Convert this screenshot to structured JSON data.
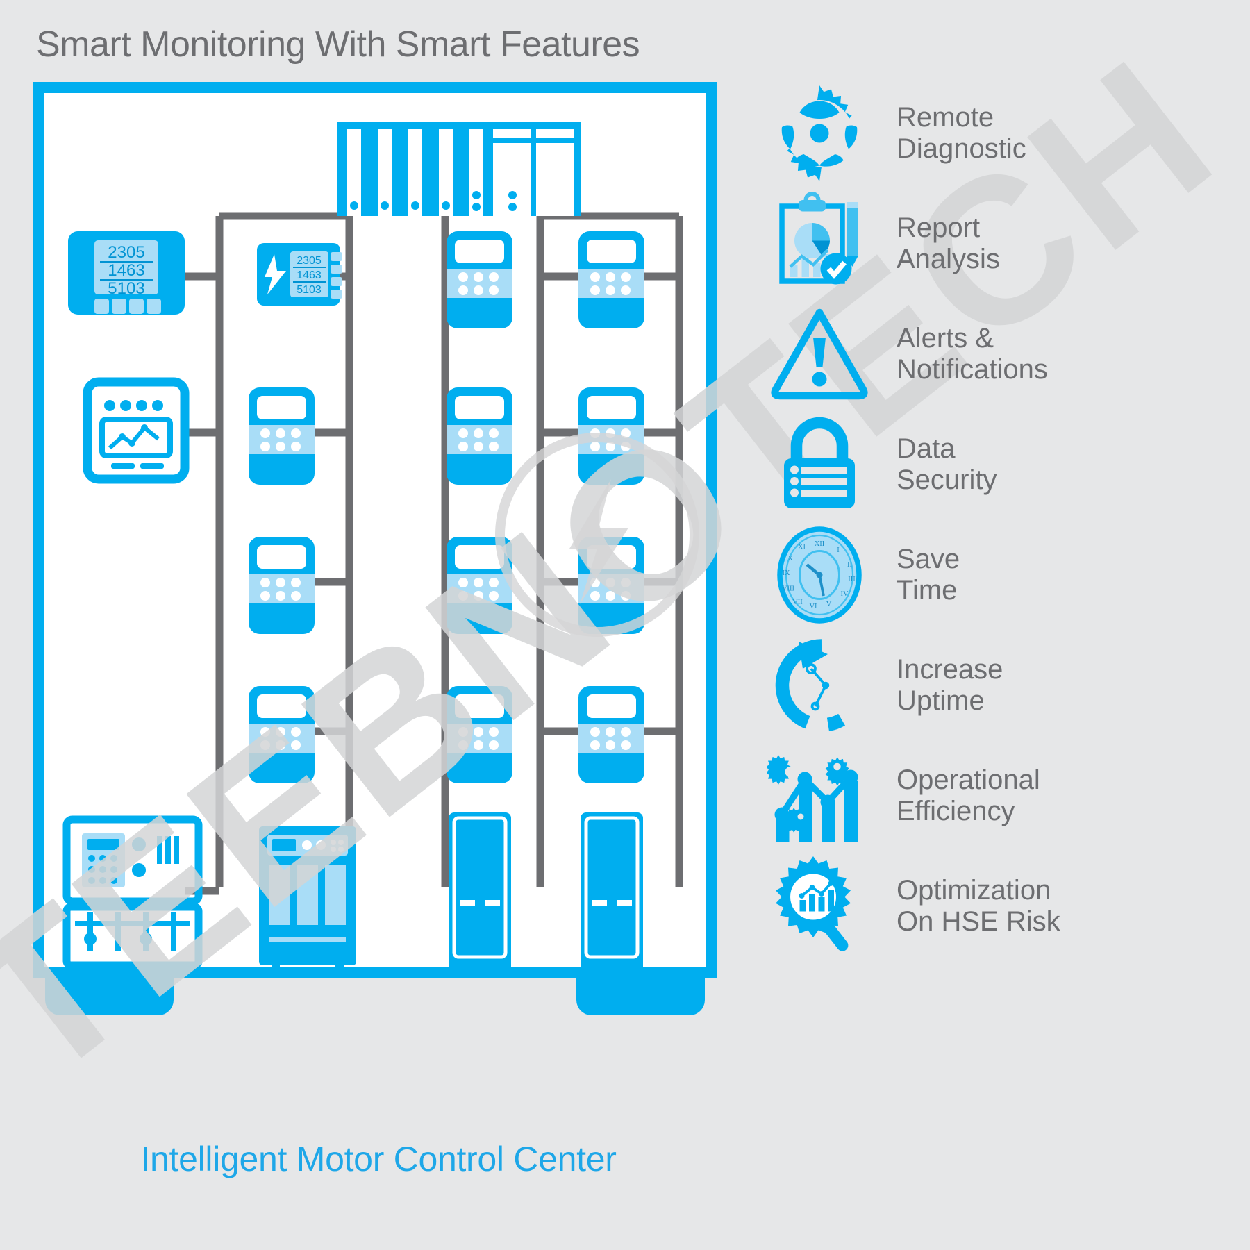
{
  "header": {
    "title": "Smart Monitoring With Smart Features"
  },
  "cabinet": {
    "caption": "Intelligent Motor Control Center",
    "accent_color": "#00aeef",
    "accent_light": "#a9ddf7",
    "accent_mid": "#41c0f0",
    "wire_color": "#6d6e71",
    "background": "#ffffff",
    "page_background": "#e6e7e8",
    "text_color": "#6d6e71"
  },
  "watermark": {
    "text": "TEEBNOTECH"
  },
  "meters": {
    "display_values": [
      "2305",
      "1463",
      "5103"
    ],
    "power_meter_name": "power-meter-display",
    "relay_name": "protection-relay-display"
  },
  "devices": [
    {
      "name": "plc-rack",
      "label": "PLC Rack"
    },
    {
      "name": "power-meter",
      "label": "Power Meter"
    },
    {
      "name": "protection-relay",
      "label": "Protection Relay"
    },
    {
      "name": "monitoring-display",
      "label": "Monitoring Display"
    },
    {
      "name": "operator-console",
      "label": "Operator Console"
    },
    {
      "name": "switchgear-panel",
      "label": "Switchgear Panel"
    },
    {
      "name": "mcc-bucket",
      "label": "MCC Bucket"
    },
    {
      "name": "vertical-drive-cabinet",
      "label": "Drive Cabinet"
    }
  ],
  "features": [
    {
      "icon": "gear-icon",
      "label": "Remote\nDiagnostic"
    },
    {
      "icon": "clipboard-chart-icon",
      "label": "Report\nAnalysis"
    },
    {
      "icon": "warning-triangle-icon",
      "label": "Alerts &\nNotifications"
    },
    {
      "icon": "padlock-icon",
      "label": "Data\nSecurity"
    },
    {
      "icon": "clock-icon",
      "label": "Save\nTime"
    },
    {
      "icon": "uptime-arrow-clock-icon",
      "label": "Increase\nUptime"
    },
    {
      "icon": "bar-chart-gears-icon",
      "label": "Operational\nEfficiency"
    },
    {
      "icon": "gear-magnifier-chart-icon",
      "label": "Optimization\nOn HSE Risk"
    }
  ]
}
